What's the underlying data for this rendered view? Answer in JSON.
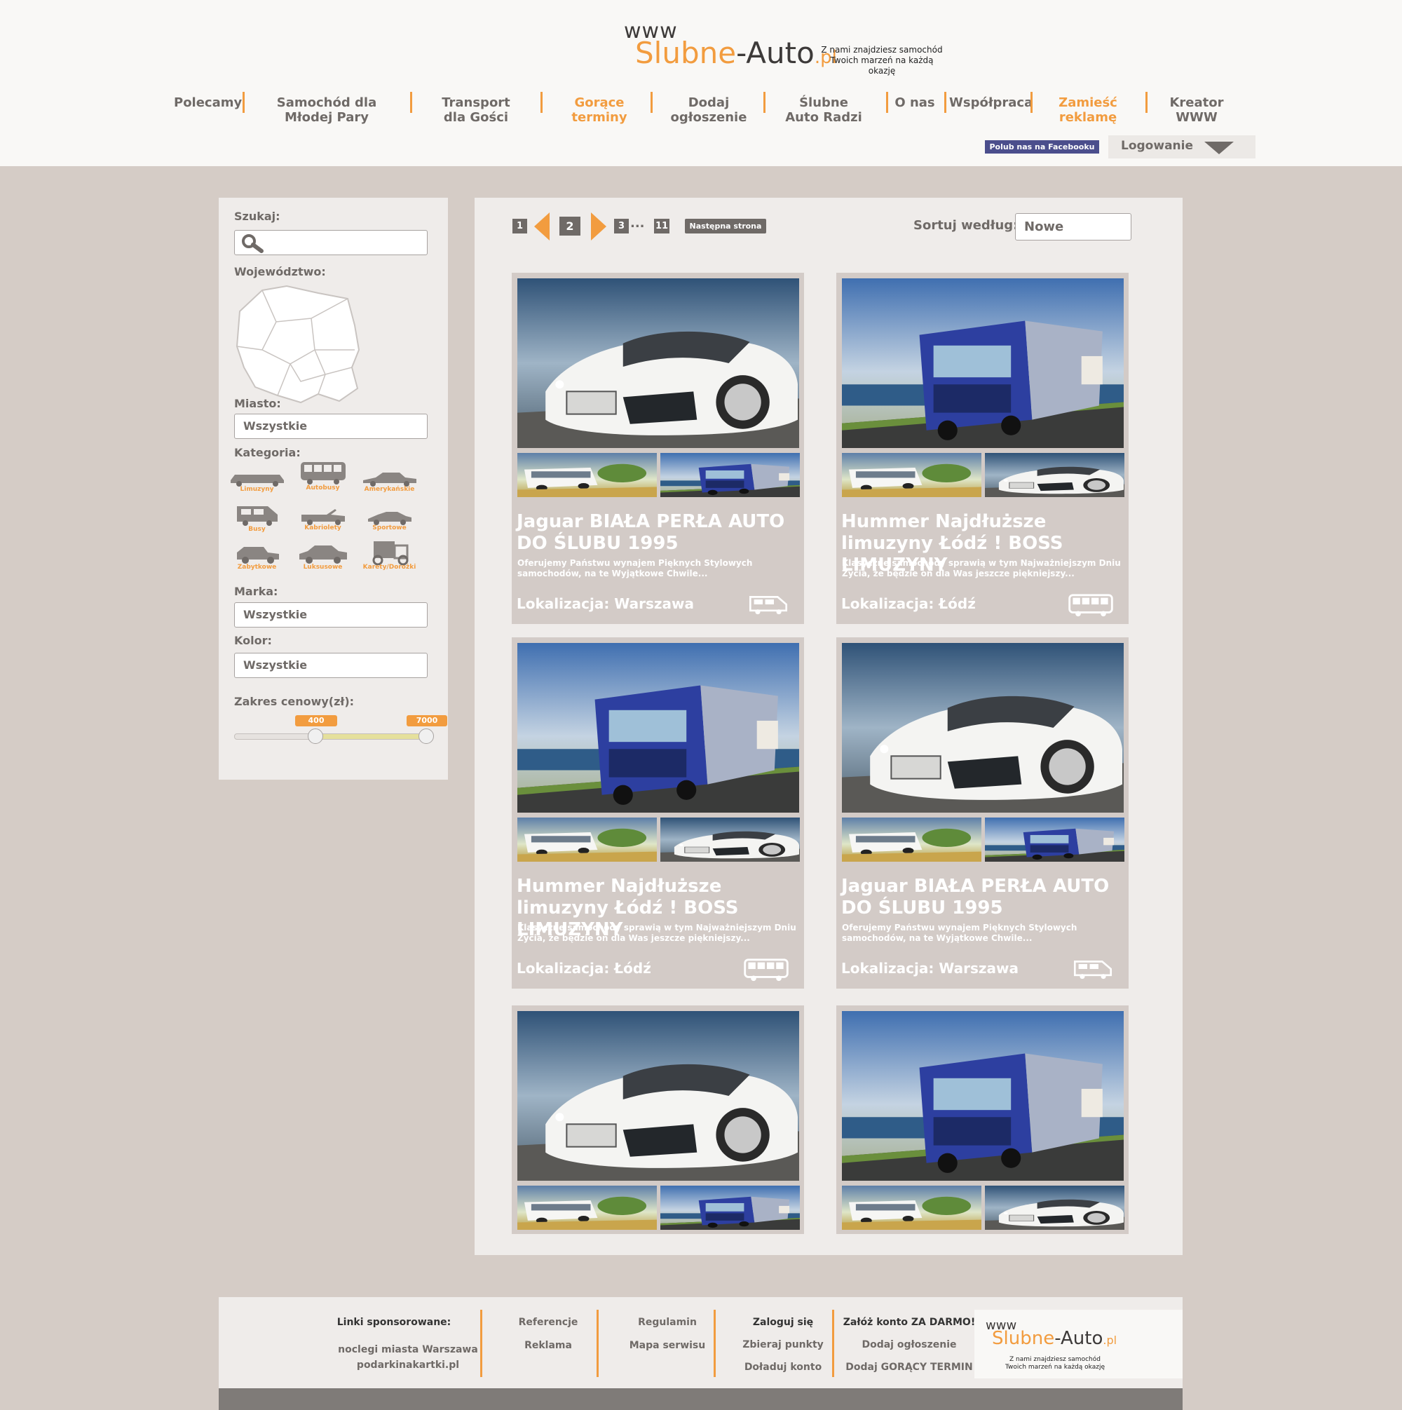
{
  "header": {
    "logo": {
      "www": "www",
      "main_a": "Slubne",
      "main_b": "-Auto",
      "main_c": ".pl"
    },
    "tagline_1": "Z nami znajdziesz samochód",
    "tagline_2": "Twoich marzeń na każdą okazję",
    "nav": [
      {
        "label": "Polecamy"
      },
      {
        "label": "Samochód dla Młodej Pary"
      },
      {
        "label": "Transport dla Gości"
      },
      {
        "label": "Gorące terminy"
      },
      {
        "label": "Dodaj ogłoszenie"
      },
      {
        "label": "Ślubne Auto Radzi"
      },
      {
        "label": "O nas"
      },
      {
        "label": "Współpraca"
      },
      {
        "label": "Zamieść reklamę"
      },
      {
        "label": "Kreator WWW"
      }
    ],
    "facebook": "Polub nas na Facebooku",
    "login": "Logowanie"
  },
  "sidebar": {
    "search_label": "Szukaj:",
    "province_label": "Województwo:",
    "city_label": "Miasto:",
    "city_value": "Wszystkie",
    "category_label": "Kategoria:",
    "categories": [
      "Limuzyny",
      "Autobusy",
      "Amerykańskie",
      "Busy",
      "Kabriolety",
      "Sportowe",
      "Zabytkowe",
      "Luksusowe",
      "Karety/Dorożki"
    ],
    "brand_label": "Marka:",
    "brand_value": "Wszystkie",
    "color_label": "Kolor:",
    "color_value": "Wszystkie",
    "price_label": "Zakres cenowy(zł):",
    "price_min": "400",
    "price_max": "7000"
  },
  "pagination": {
    "p1": "1",
    "p2": "2",
    "p3": "3",
    "dots": "...",
    "p11": "11",
    "next": "Następna strona"
  },
  "sort": {
    "label": "Sortuj według:",
    "value": "Nowe"
  },
  "listings": [
    {
      "title": "Jaguar BIAŁA PERŁA AUTO DO ŚLUBU 1995",
      "desc": "Oferujemy Państwu wynajem Pięknych Stylowych samochodów, na te Wyjątkowe Chwile...",
      "location": "Lokalizacja: Warszawa",
      "vehicle_icon": "van-icon"
    },
    {
      "title": "Hummer Najdłuższe limuzyny Łódź ! BOSS LIMUZYNY",
      "desc": "Klasyczne samochody sprawią w tym Najważniejszym Dniu Życia, że będzie on dla Was jeszcze piękniejszy...",
      "location": "Lokalizacja: Łódź",
      "vehicle_icon": "bus-icon"
    },
    {
      "title": "Hummer Najdłuższe limuzyny Łódź ! BOSS LIMUZYNY",
      "desc": "Klasyczne samochody sprawią w tym Najważniejszym Dniu Życia, że będzie on dla Was jeszcze piękniejszy...",
      "location": "Lokalizacja: Łódź",
      "vehicle_icon": "bus-icon"
    },
    {
      "title": "Jaguar BIAŁA PERŁA AUTO DO ŚLUBU 1995",
      "desc": "Oferujemy Państwu wynajem Pięknych Stylowych samochodów, na te Wyjątkowe Chwile...",
      "location": "Lokalizacja: Warszawa",
      "vehicle_icon": "van-icon"
    }
  ],
  "footer": {
    "sponsored_heading": "Linki sponsorowane:",
    "sponsored_1": "noclegi miasta Warszawa",
    "sponsored_2": "podarkinakartki.pl",
    "col1": [
      "Referencje",
      "Reklama"
    ],
    "col2": [
      "Regulamin",
      "Mapa serwisu"
    ],
    "col3_heading": "Zaloguj się",
    "col3": [
      "Zbieraj punkty",
      "Doładuj konto"
    ],
    "col4_heading": "Załóż konto ZA DARMO!",
    "col4": [
      "Dodaj ogłoszenie",
      "Dodaj GORĄCY TERMIN"
    ],
    "tagline_1": "Z nami znajdziesz samochód",
    "tagline_2": "Twoich marzeń na każdą okazję"
  },
  "colors": {
    "accent": "#f29c3f",
    "text": "#6f6a67",
    "background": "#d5ccc6",
    "panel": "#efecea",
    "card": "#d3cbc7",
    "facebook": "#4b4e8c"
  }
}
